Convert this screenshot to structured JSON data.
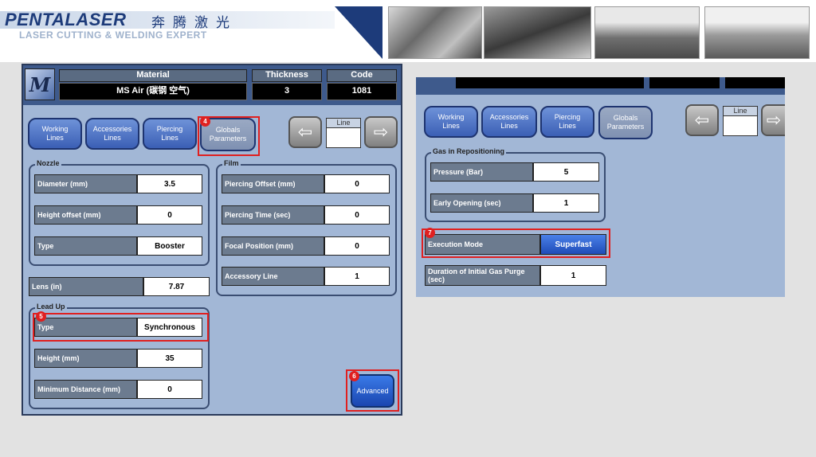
{
  "header": {
    "logo": "PENTALASER",
    "logo_cn": "奔腾激光",
    "tagline": "LASER CUTTING & WELDING EXPERT"
  },
  "left": {
    "header": {
      "material_label": "Material",
      "material_value": "MS Air (碳钢 空气)",
      "thickness_label": "Thickness",
      "thickness_value": "3",
      "code_label": "Code",
      "code_value": "1081"
    },
    "tabs": [
      {
        "label": "Working\nLines"
      },
      {
        "label": "Accessories\nLines"
      },
      {
        "label": "Piercing\nLines"
      },
      {
        "label": "Globals\nParameters"
      }
    ],
    "line_label": "Line",
    "nozzle": {
      "title": "Nozzle",
      "rows": [
        {
          "label": "Diameter (mm)",
          "value": "3.5"
        },
        {
          "label": "Height offset (mm)",
          "value": "0"
        },
        {
          "label": "Type",
          "value": "Booster"
        }
      ]
    },
    "film": {
      "title": "Film",
      "rows": [
        {
          "label": "Piercing Offset (mm)",
          "value": "0"
        },
        {
          "label": "Piercing Time (sec)",
          "value": "0"
        },
        {
          "label": "Focal Position (mm)",
          "value": "0"
        },
        {
          "label": "Accessory Line",
          "value": "1"
        }
      ]
    },
    "lens": {
      "label": "Lens (in)",
      "value": "7.87"
    },
    "leadup": {
      "title": "Lead Up",
      "rows": [
        {
          "label": "Type",
          "value": "Synchronous"
        },
        {
          "label": "Height (mm)",
          "value": "35"
        },
        {
          "label": "Minimum Distance (mm)",
          "value": "0"
        }
      ]
    },
    "advanced": "Advanced"
  },
  "right": {
    "tabs": [
      {
        "label": "Working\nLines"
      },
      {
        "label": "Accessories\nLines"
      },
      {
        "label": "Piercing\nLines"
      },
      {
        "label": "Globals\nParameters"
      }
    ],
    "line_label": "Line",
    "gas": {
      "title": "Gas in Repositioning",
      "rows": [
        {
          "label": "Pressure (Bar)",
          "value": "5"
        },
        {
          "label": "Early Opening (sec)",
          "value": "1"
        }
      ]
    },
    "execution": {
      "label": "Execution Mode",
      "value": "Superfast"
    },
    "duration": {
      "label": "Duration of Initial Gas Purge (sec)",
      "value": "1"
    }
  },
  "badges": [
    "4",
    "5",
    "6",
    "7"
  ],
  "colors": {
    "accent_red": "#e02020",
    "brand_blue": "#1d3b7a",
    "panel": "#a2b7d6"
  }
}
